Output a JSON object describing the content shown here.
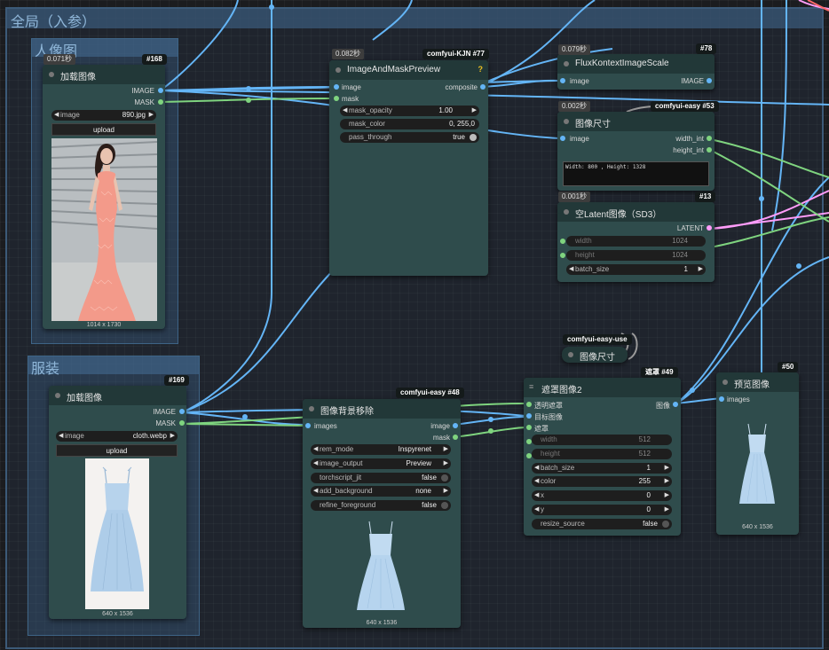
{
  "groups": {
    "global_title": "全局（入参）",
    "portrait_title": "人像图",
    "clothing_title": "服装"
  },
  "colors": {
    "image_wire": "#64b5f6",
    "mask_wire": "#7fd47f",
    "latent_wire": "#ff9cf9",
    "int_wire": "#7fd47f"
  },
  "n168": {
    "badge": "#168",
    "timer": "0.071秒",
    "title": "加载图像",
    "out_image": "IMAGE",
    "out_mask": "MASK",
    "image_label": "image",
    "image_value": "890.jpg",
    "upload": "upload",
    "dims": "1014 x 1730",
    "preview_icon": "woman-pink-dress-photo"
  },
  "n77": {
    "badge": "comfyui-KJN #77",
    "timer": "0.082秒",
    "title": "ImageAndMaskPreview",
    "help": "?",
    "in_image": "image",
    "in_mask": "mask",
    "out_composite": "composite",
    "opacity_label": "mask_opacity",
    "opacity_value": "1.00",
    "color_label": "mask_color",
    "color_value": "0, 255,0",
    "pass_label": "pass_through",
    "pass_value": "true"
  },
  "n78": {
    "badge": "#78",
    "timer": "0.079秒",
    "title": "FluxKontextImageScale",
    "in_image": "image",
    "out_image": "IMAGE"
  },
  "n53": {
    "badge": "comfyui-easy #53",
    "timer": "0.002秒",
    "title": "图像尺寸",
    "in_image": "image",
    "out_width": "width_int",
    "out_height": "height_int",
    "text": "Width: 800 , Height: 1328"
  },
  "n13": {
    "badge": "#13",
    "timer": "0.001秒",
    "title": "空Latent图像（SD3）",
    "out_latent": "LATENT",
    "width_label": "width",
    "width_value": "1024",
    "height_label": "height",
    "height_value": "1024",
    "batch_label": "batch_size",
    "batch_value": "1"
  },
  "n169": {
    "badge": "#169",
    "title": "加载图像",
    "out_image": "IMAGE",
    "out_mask": "MASK",
    "image_label": "image",
    "image_value": "cloth.webp",
    "upload": "upload",
    "dims": "640 x 1536",
    "preview_icon": "blue-dress-photo"
  },
  "n48": {
    "badge": "comfyui-easy #48",
    "title": "图像背景移除",
    "in_images": "images",
    "out_image": "image",
    "out_mask": "mask",
    "rem_label": "rem_mode",
    "rem_value": "Inspyrenet",
    "out_label": "image_output",
    "out_value": "Preview",
    "ts_label": "torchscript_jit",
    "ts_value": "false",
    "bg_label": "add_background",
    "bg_value": "none",
    "rf_label": "refine_foreground",
    "rf_value": "false",
    "dims": "640 x 1536"
  },
  "size_node": {
    "badge": "comfyui-easy-use",
    "title": "图像尺寸"
  },
  "n49": {
    "badge": "遮罩 #49",
    "title": "遮罩图像2",
    "menu_icon": "≡",
    "in1": "透明遮罩",
    "in2": "目标图像",
    "in3": "遮罩",
    "out": "图像",
    "width_label": "width",
    "width_value": "512",
    "height_label": "height",
    "height_value": "512",
    "batch_label": "batch_size",
    "batch_value": "1",
    "color_label": "color",
    "color_value": "255",
    "x_label": "x",
    "x_value": "0",
    "y_label": "y",
    "y_value": "0",
    "rs_label": "resize_source",
    "rs_value": "false"
  },
  "n50": {
    "badge": "#50",
    "title": "预览图像",
    "in_images": "images",
    "dims": "640 x 1536"
  }
}
